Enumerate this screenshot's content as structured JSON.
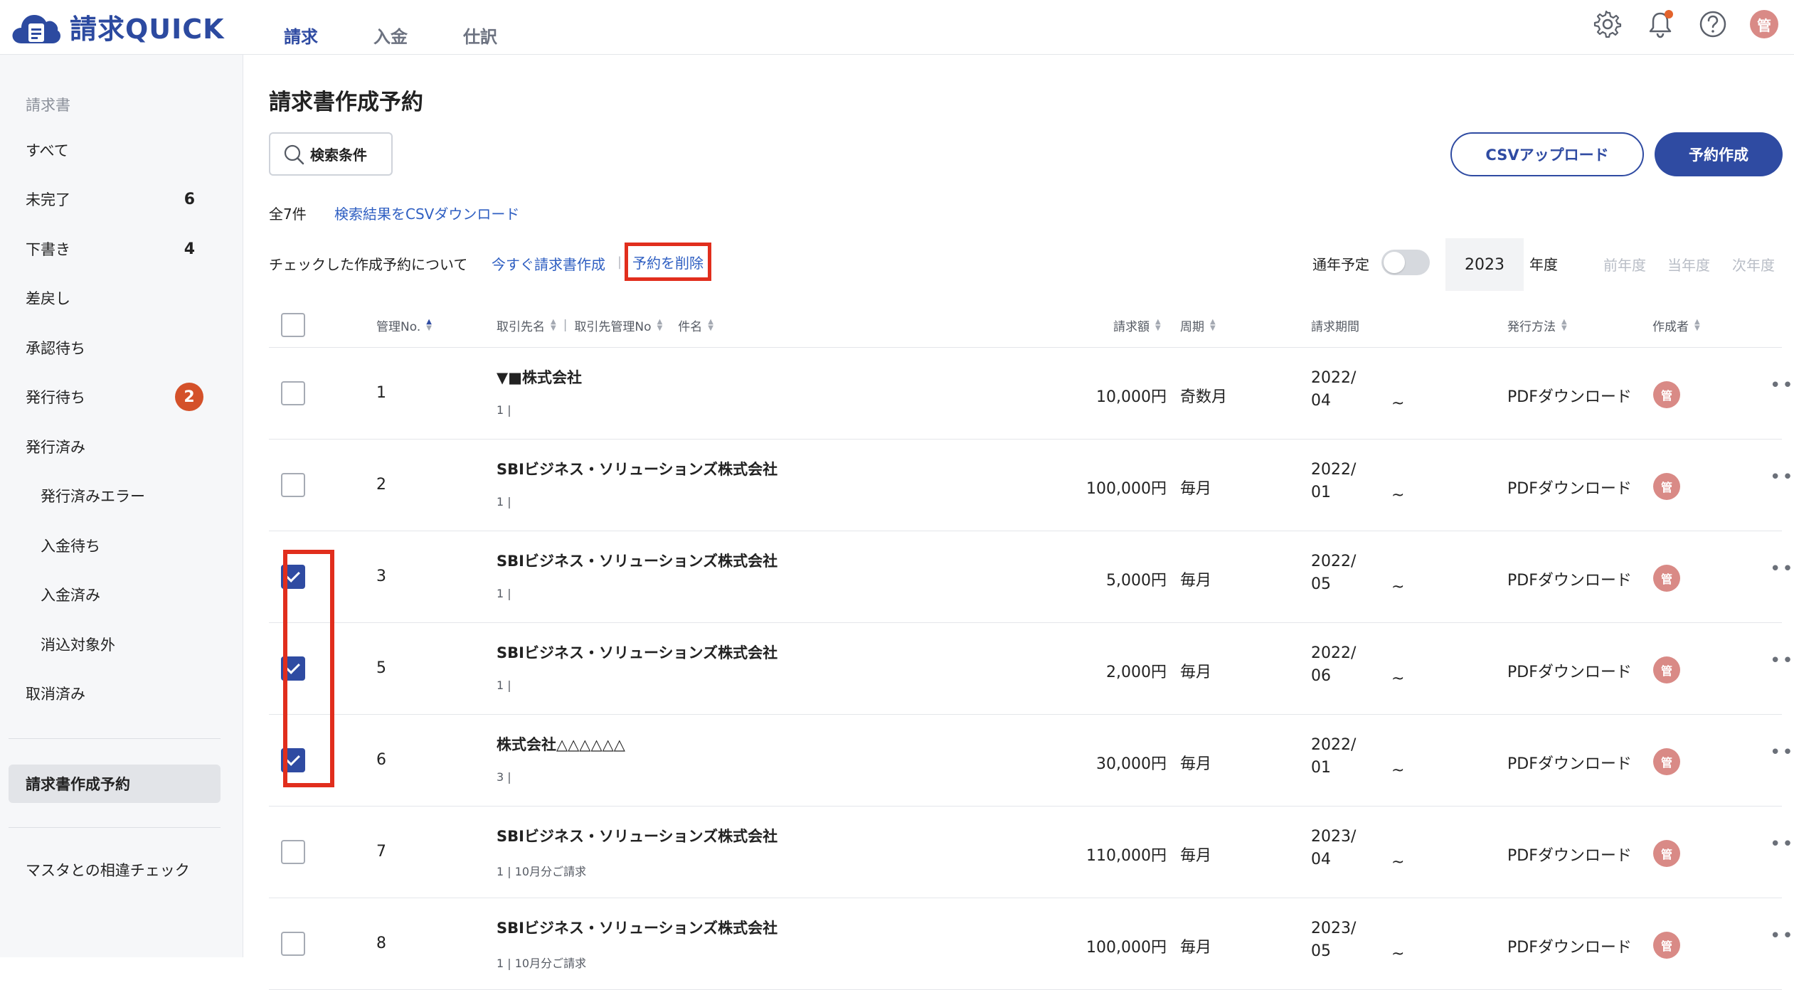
{
  "app": {
    "name": "請求QUICK"
  },
  "nav": {
    "tabs": [
      {
        "label": "請求"
      },
      {
        "label": "入金"
      },
      {
        "label": "仕訳"
      }
    ]
  },
  "header": {
    "avatar_initial": "管"
  },
  "sidebar": {
    "section": "請求書",
    "items": [
      {
        "label": "すべて"
      },
      {
        "label": "未完了",
        "count": "6"
      },
      {
        "label": "下書き",
        "count": "4"
      },
      {
        "label": "差戻し"
      },
      {
        "label": "承認待ち"
      },
      {
        "label": "発行待ち",
        "badge": "2"
      },
      {
        "label": "発行済み"
      },
      {
        "label": "発行済みエラー"
      },
      {
        "label": "入金待ち"
      },
      {
        "label": "入金済み"
      },
      {
        "label": "消込対象外"
      },
      {
        "label": "取消済み"
      }
    ],
    "active_item": "請求書作成予約",
    "bottom_item": "マスタとの相違チェック"
  },
  "main": {
    "title": "請求書作成予約",
    "search_label": "検索条件",
    "csv_upload_label": "CSVアップロード",
    "create_label": "予約作成",
    "total": "全7件",
    "csv_download_label": "検索結果をCSVダウンロード",
    "bulk_label": "チェックした作成予約について",
    "bulk_issue_label": "今すぐ請求書作成",
    "bulk_separator": "|",
    "bulk_delete_label": "予約を削除",
    "yearly_label": "通年予定",
    "year": "2023",
    "year_unit": "年度",
    "prev_year": "前年度",
    "current_year": "当年度",
    "next_year": "次年度"
  },
  "table": {
    "headers": {
      "no": "管理No.",
      "partner": "取引先名",
      "partner_no": "取引先管理No",
      "subject": "件名",
      "amount": "請求額",
      "cycle": "周期",
      "period": "請求期間",
      "method": "発行方法",
      "author": "作成者",
      "separator": "|"
    },
    "rows": [
      {
        "no": "1",
        "name": "▼■株式会社",
        "sub": "1 |",
        "amount": "10,000円",
        "cycle": "奇数月",
        "period1": "2022/",
        "period2": "04",
        "tilde": "~",
        "method": "PDFダウンロード",
        "author": "管",
        "menu": "•••",
        "checked": false
      },
      {
        "no": "2",
        "name": "SBIビジネス・ソリューションズ株式会社",
        "sub": "1 |",
        "amount": "100,000円",
        "cycle": "毎月",
        "period1": "2022/",
        "period2": "01",
        "tilde": "~",
        "method": "PDFダウンロード",
        "author": "管",
        "menu": "•••",
        "checked": false
      },
      {
        "no": "3",
        "name": "SBIビジネス・ソリューションズ株式会社",
        "sub": "1 |",
        "amount": "5,000円",
        "cycle": "毎月",
        "period1": "2022/",
        "period2": "05",
        "tilde": "~",
        "method": "PDFダウンロード",
        "author": "管",
        "menu": "•••",
        "checked": true
      },
      {
        "no": "5",
        "name": "SBIビジネス・ソリューションズ株式会社",
        "sub": "1 |",
        "amount": "2,000円",
        "cycle": "毎月",
        "period1": "2022/",
        "period2": "06",
        "tilde": "~",
        "method": "PDFダウンロード",
        "author": "管",
        "menu": "•••",
        "checked": true
      },
      {
        "no": "6",
        "name": "株式会社△△△△△△",
        "sub": "3 |",
        "amount": "30,000円",
        "cycle": "毎月",
        "period1": "2022/",
        "period2": "01",
        "tilde": "~",
        "method": "PDFダウンロード",
        "author": "管",
        "menu": "•••",
        "checked": true
      },
      {
        "no": "7",
        "name": "SBIビジネス・ソリューションズ株式会社",
        "sub": "1 | 10月分ご請求",
        "amount": "110,000円",
        "cycle": "毎月",
        "period1": "2023/",
        "period2": "04",
        "tilde": "~",
        "method": "PDFダウンロード",
        "author": "管",
        "menu": "•••",
        "checked": false
      },
      {
        "no": "8",
        "name": "SBIビジネス・ソリューションズ株式会社",
        "sub": "1 | 10月分ご請求",
        "amount": "100,000円",
        "cycle": "毎月",
        "period1": "2023/",
        "period2": "05",
        "tilde": "~",
        "method": "PDFダウンロード",
        "author": "管",
        "menu": "•••",
        "checked": false
      }
    ]
  },
  "colors": {
    "primary": "#2f4ba2",
    "link": "#2f5fc2",
    "highlight": "#e12e1d",
    "badge": "#d4512a",
    "avatar": "#d98a86"
  }
}
